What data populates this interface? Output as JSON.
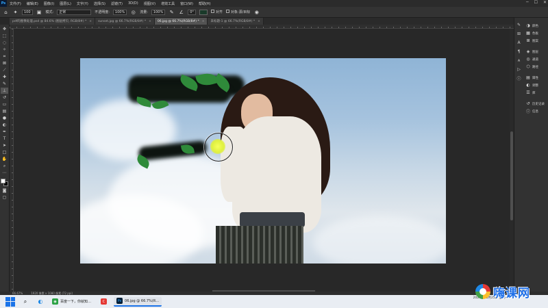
{
  "app": {
    "logo": "Ps"
  },
  "menubar": {
    "items": [
      "文件(F)",
      "编辑(E)",
      "图像(I)",
      "图层(L)",
      "文字(Y)",
      "选择(S)",
      "滤镜(T)",
      "3D(D)",
      "视图(V)",
      "增效工具",
      "窗口(W)",
      "帮助(H)"
    ]
  },
  "options": {
    "size": "100",
    "mode_label": "模式:",
    "mode_value": "正常",
    "opacity_label": "不透明度:",
    "opacity_value": "100%",
    "flow_label": "流量:",
    "flow_value": "100%",
    "angle_value": "0°",
    "align_label": "对齐",
    "sample_label": "对象:源/目标"
  },
  "tabs": [
    {
      "label": "pdf的图像处理.psd @ 84.6% (图层拷贝, RGB/8#) *"
    },
    {
      "label": "sunset.jpg @ 66.7%(RGB/8#) *"
    },
    {
      "label": "06.jpg @ 66.7%(RGB/8#) *"
    },
    {
      "label": "未标题-1 @ 66.7%(RGB/8#) *"
    }
  ],
  "panels": [
    {
      "icon": "palette",
      "label": "颜色"
    },
    {
      "icon": "swatches",
      "label": "色板"
    },
    {
      "icon": "grid",
      "label": "图案"
    },
    {
      "icon": "layers",
      "label": "图层"
    },
    {
      "icon": "channels",
      "label": "通道"
    },
    {
      "icon": "paths",
      "label": "路径"
    },
    {
      "icon": "properties",
      "label": "属性"
    },
    {
      "icon": "adjust",
      "label": "调整"
    },
    {
      "icon": "libraries",
      "label": "库"
    },
    {
      "icon": "history",
      "label": "历史记录"
    },
    {
      "icon": "info",
      "label": "信息"
    }
  ],
  "status": {
    "zoom": "66.67%",
    "doc": "1920 像素 x 1080 像素 (72 ppi)"
  },
  "taskbar": {
    "items": [
      {
        "label": "百度一下，你就知…",
        "color": "#2ba245"
      },
      {
        "label": "",
        "color": "#e53935"
      },
      {
        "label": "06.jpg @ 66.7%(R…",
        "color": "#001e36"
      }
    ],
    "time": "",
    "date": "2024年03月25日 星期一"
  },
  "watermark": {
    "text": "嗨课网"
  }
}
